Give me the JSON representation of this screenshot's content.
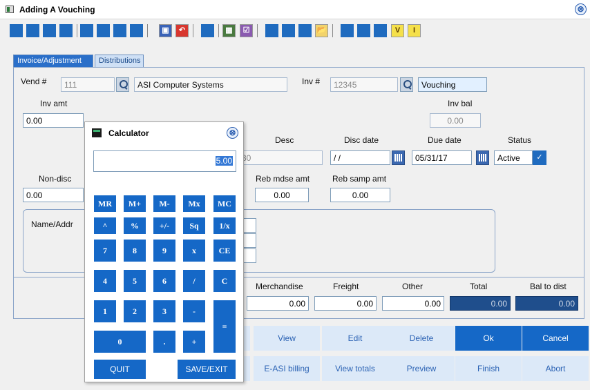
{
  "window": {
    "title": "Adding A Vouching",
    "close_icon": "⊗"
  },
  "toolbar": {
    "pdf_icon": "▣",
    "undo_icon": "↶",
    "grid_icon": "▦",
    "check_icon": "☑",
    "folder_icon": "📂",
    "v_label": "V",
    "i_label": "I"
  },
  "tabs": [
    {
      "label": "Invoice/Adjustment"
    },
    {
      "label": "Distributions"
    }
  ],
  "form": {
    "vend_label": "Vend #",
    "vend_value": "111",
    "vend_name": "ASI Computer Systems",
    "inv_label": "Inv #",
    "inv_value": "12345",
    "inv_desc": "Vouching",
    "inv_amt_label": "Inv amt",
    "inv_amt_value": "0.00",
    "inv_bal_label": "Inv bal",
    "inv_bal_value": "0.00",
    "desc_label": "Desc",
    "desc_value_partial": "30",
    "disc_date_label": "Disc date",
    "disc_date_value": "/ /",
    "due_date_label": "Due date",
    "due_date_value": "05/31/17",
    "status_label": "Status",
    "status_value": "Active",
    "non_disc_label": "Non-disc",
    "non_disc_value": "0.00",
    "reb_mdse_label": "Reb mdse amt",
    "reb_mdse_value": "0.00",
    "reb_samp_label": "Reb samp amt",
    "reb_samp_value": "0.00",
    "name_addr_label": "Name/Addr"
  },
  "totals": {
    "merch_label": "Merchandise",
    "merch_value": "0.00",
    "freight_label": "Freight",
    "freight_value": "0.00",
    "other_label": "Other",
    "other_value": "0.00",
    "total_label": "Total",
    "total_value": "0.00",
    "bal_label": "Bal to dist",
    "bal_value": "0.00"
  },
  "actions": {
    "view": "View",
    "edit": "Edit",
    "delete": "Delete",
    "ok": "Ok",
    "cancel": "Cancel",
    "easi": "E-ASI billing",
    "view_totals": "View totals",
    "preview": "Preview",
    "finish": "Finish",
    "abort": "Abort"
  },
  "calculator": {
    "title": "Calculator",
    "close_icon": "⊗",
    "display": "5.00",
    "keys": {
      "mr": "MR",
      "mplus": "M+",
      "mminus": "M-",
      "mx": "Mx",
      "mc": "MC",
      "pow": "^",
      "pct": "%",
      "neg": "+/-",
      "sq": "Sq",
      "inv": "1/x",
      "k7": "7",
      "k8": "8",
      "k9": "9",
      "mul": "x",
      "ce": "CE",
      "k4": "4",
      "k5": "5",
      "k6": "6",
      "div": "/",
      "clr": "C",
      "k1": "1",
      "k2": "2",
      "k3": "3",
      "sub": "-",
      "eq": "=",
      "k0": "0",
      "dot": ".",
      "add": "+"
    },
    "quit": "QUIT",
    "save_exit": "SAVE/EXIT"
  }
}
